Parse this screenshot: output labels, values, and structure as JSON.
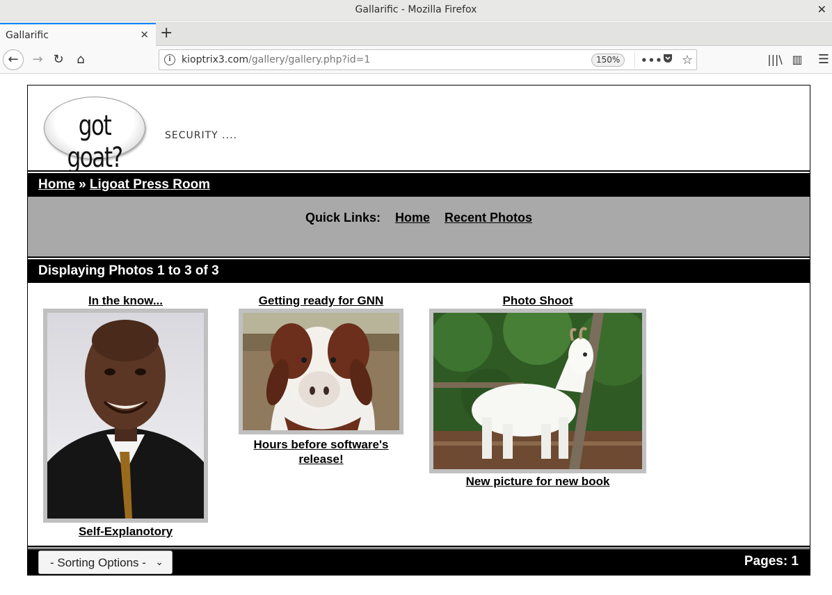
{
  "window": {
    "title": "Gallarific - Mozilla Firefox",
    "close": "✕"
  },
  "tabs": [
    {
      "label": "Gallarific",
      "close": "✕"
    }
  ],
  "toolbar": {
    "new_tab": "+",
    "back": "←",
    "forward": "→",
    "reload": "↻",
    "home": "⌂",
    "url_host": "kioptrix3.com",
    "url_path": "/gallery/gallery.php?id=1",
    "zoom": "150%",
    "more": "•••",
    "library": "|||\\",
    "sidebar": "▥",
    "menu": "☰"
  },
  "header": {
    "logo_text": "got goat?",
    "tagline": "SECURITY ...."
  },
  "breadcrumb": {
    "home": "Home",
    "separator": " » ",
    "current": "Ligoat Press Room"
  },
  "quick_links": {
    "label": "Quick Links:",
    "home": "Home",
    "recent": "Recent Photos"
  },
  "display": {
    "text": "Displaying Photos 1 to 3 of 3"
  },
  "photos": [
    {
      "title": "In the know...",
      "caption": "Self-Explanotory"
    },
    {
      "title": "Getting ready for GNN",
      "caption": "Hours before software's release!"
    },
    {
      "title": "Photo Shoot",
      "caption": "New picture for new book"
    }
  ],
  "footer": {
    "sort_label": "- Sorting Options -",
    "pages": "Pages: 1"
  },
  "colors": {
    "bar": "#000000",
    "quick_bg": "#a9a9a9",
    "frame": "#c0c0c0",
    "tab_accent": "#0a84ff"
  }
}
